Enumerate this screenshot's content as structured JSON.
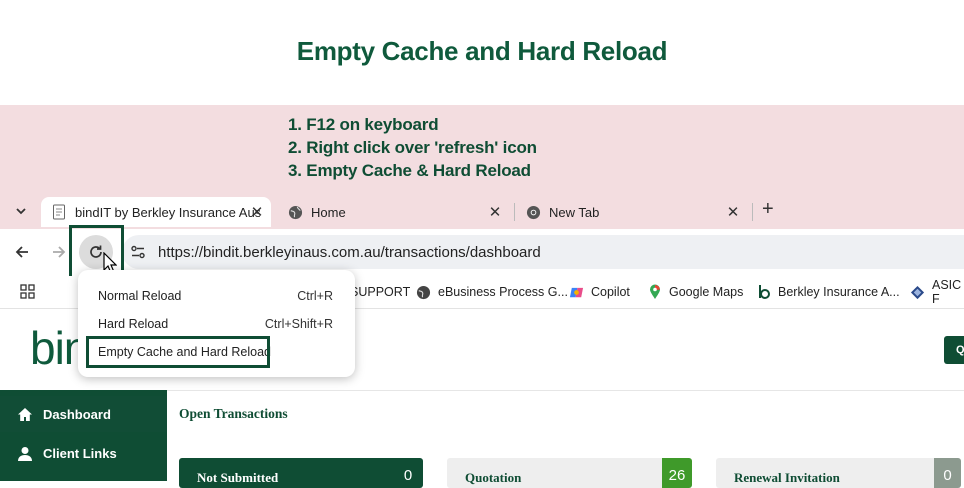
{
  "title": "Empty Cache and Hard Reload",
  "steps": [
    "1.  F12 on keyboard",
    "2. Right click over 'refresh' icon",
    "3. Empty Cache & Hard Reload"
  ],
  "browser": {
    "tabs": [
      {
        "label": "bindIT by Berkley Insurance Aus",
        "close": "✕"
      },
      {
        "label": "Home",
        "close": "✕"
      },
      {
        "label": "New Tab",
        "close": "✕"
      }
    ],
    "new_tab": "+",
    "url": "https://bindit.berkleyinaus.com.au/transactions/dashboard",
    "bookmarks": [
      {
        "label": "SUPPORT"
      },
      {
        "label": "eBusiness Process G..."
      },
      {
        "label": "Copilot"
      },
      {
        "label": "Google Maps"
      },
      {
        "label": "Berkley Insurance A..."
      },
      {
        "label": "ASIC F"
      }
    ]
  },
  "context_menu": {
    "items": [
      {
        "label": "Normal Reload",
        "shortcut": "Ctrl+R"
      },
      {
        "label": "Hard Reload",
        "shortcut": "Ctrl+Shift+R"
      },
      {
        "label": "Empty Cache and Hard Reload",
        "shortcut": ""
      }
    ]
  },
  "app": {
    "logo": "bind",
    "header_button": "Q",
    "sidebar": [
      {
        "label": "Dashboard",
        "icon": "home-icon"
      },
      {
        "label": "Client Links",
        "icon": "user-icon"
      }
    ],
    "section_title": "Open Transactions",
    "cards": [
      {
        "label": "Not Submitted",
        "count": "0"
      },
      {
        "label": "Quotation",
        "count": "26"
      },
      {
        "label": "Renewal Invitation",
        "count": "0"
      }
    ]
  },
  "colors": {
    "brand": "#0f4d34",
    "band": "#f3dde0",
    "quote_badge": "#3f9a2a"
  }
}
